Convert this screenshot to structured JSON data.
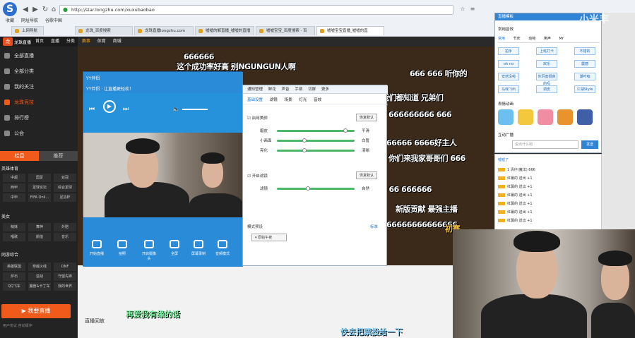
{
  "browser": {
    "url": "http://star.longzhu.com/xuxubaobao",
    "bookmarks": [
      "收藏",
      "网址导航",
      "谷歌中国"
    ],
    "bookmarks2": [
      "上网导航"
    ],
    "tabs": [
      "龙珠_百度搜索",
      "龙珠直播longzhu.com",
      "嘘嘘的解直播_嘘嘘的直播",
      "嘘嘘宝宝_百度搜索 · 百",
      "嘘嘘宝宝直播_嘘嘘的直"
    ]
  },
  "site": {
    "name": "龙珠直播",
    "topnav": [
      "首页",
      "直播",
      "分类",
      "赛事",
      "体育",
      "商城"
    ],
    "sidebar": [
      "全部直播",
      "全部分类",
      "我的关注",
      "龙珠竞技",
      "排行榜",
      "公会"
    ],
    "side_tabs": [
      "栏目",
      "推荐"
    ],
    "cat1_title": "英雄体育",
    "cat1": [
      "中超",
      "国足",
      "亚冠",
      "西甲",
      "足球论坛",
      "综合足球",
      "中甲",
      "FIFA Onli...",
      "足协杯"
    ],
    "cat2_title": "美女",
    "cat2": [
      "萌妹",
      "舞神",
      "外陪",
      "唱歌",
      "颜值",
      "音乐"
    ],
    "cat3_title": "网游综合",
    "cat3": [
      "英雄联盟",
      "穿越火线",
      "DNF",
      "炉石",
      "逆战",
      "守望先锋",
      "QQ飞车",
      "魔兽&卡丁车",
      "我的世界"
    ],
    "live_button": "我要直播",
    "footer": "用户协议    自动缓冲",
    "bottom_title": "直播回放"
  },
  "danmaku": [
    "666666",
    "这个成功率好高 别NGUNGUN人啊",
    "666 666 听你的",
    "我们都知道 兄弟们",
    "666666666 666",
    "666666 6666好主人",
    "你们来我家哥哥们 666",
    "6 66 666666",
    "新版贡献 最强主播",
    "666666666666666",
    "初赛"
  ],
  "yy": {
    "title": "YY伴侣",
    "subtitle": "YY伴侣 · 让直播更轻松！",
    "buttons": [
      "开始直播",
      "拍照",
      "开启摄像头",
      "全屏",
      "屏幕录制",
      "音频模式"
    ]
  },
  "settings": {
    "tabs": [
      "通知管理",
      "鲜花",
      "声音",
      "手柄",
      "切屏",
      "更多"
    ],
    "sub_tabs": [
      "基础设置",
      "滤镜",
      "场景",
      "灯光",
      "音效"
    ],
    "beauty_label": "启用美颜",
    "restore_label": "恢复默认",
    "rows": [
      {
        "name": "磨皮",
        "value": "平滑"
      },
      {
        "name": "小画面",
        "value": "白皙"
      },
      {
        "name": "亮化",
        "value": "清晰"
      }
    ],
    "slider_values": [
      0.88,
      0.35,
      0.35
    ],
    "switch_label": "开启滤镜",
    "switch_row": {
      "name": "滤镜",
      "value": "自然"
    },
    "switch_value": 0.4,
    "mode_label": "模式预设",
    "mode_value": "标准",
    "mode_select": "原始午夜"
  },
  "popup": {
    "title": "直播模板",
    "common_label": "常用音效",
    "tabs": [
      "常用",
      "节庆",
      "动物",
      "笑声",
      "Mr"
    ],
    "grid": [
      "拍手",
      "上班打卡",
      "不错的",
      "oh no",
      "欢乐",
      "震撼",
      "安培没啦",
      "你厉害很真的吗",
      "潮叶咖",
      "马戏飞出",
      "调皮",
      "江湖Style"
    ],
    "emoji_label": "表情动画",
    "broadcast_label": "互动广播",
    "broadcast_placeholder": "说点什么吧",
    "send": "发送"
  },
  "chat": {
    "header": "嘘嘘了",
    "lines": [
      "1 清仔(魔法) 666",
      "红薯的 送出 +1",
      "红薯的 送出 +1",
      "红薯的 送出 +1",
      "红薯的 送出 +1",
      "红薯的 送出 +1",
      "红薯的 送出 +1",
      "红薯的 送出 +1"
    ]
  },
  "overlay": {
    "watermark": "小米丰",
    "sub_a": "再爱我有缘的话",
    "sub_b": "快去把票投给一下"
  }
}
